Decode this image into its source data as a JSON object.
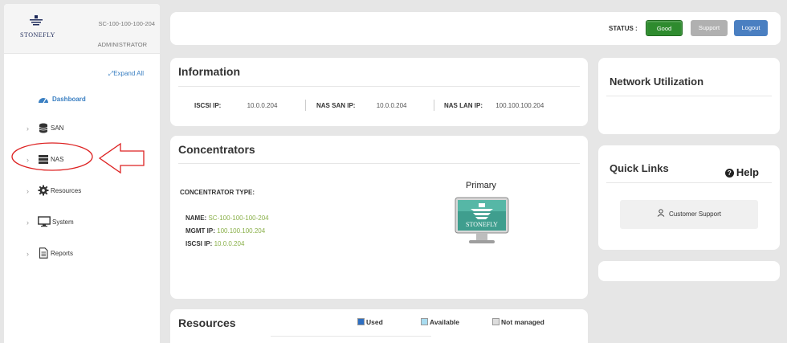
{
  "sidebar": {
    "hostname": "SC-100-100-100-204",
    "role": "ADMINISTRATOR",
    "logo_text": "STONEFLY",
    "expand_all": "Expand All",
    "dashboard": "Dashboard",
    "items": [
      {
        "label": "SAN",
        "icon": "database-icon"
      },
      {
        "label": "NAS",
        "icon": "server-icon"
      },
      {
        "label": "Resources",
        "icon": "gear-icon"
      },
      {
        "label": "System",
        "icon": "monitor-icon"
      },
      {
        "label": "Reports",
        "icon": "document-icon"
      }
    ]
  },
  "topbar": {
    "status_label": "STATUS :",
    "status_value": "Good",
    "support": "Support",
    "logout": "Logout",
    "colors": {
      "good": "#2e8b2e",
      "support": "#b0b0b0",
      "logout": "#4a7fc1"
    }
  },
  "information": {
    "title": "Information",
    "iscsi_label": "ISCSI IP:",
    "iscsi_value": "10.0.0.204",
    "nas_san_label": "NAS SAN IP:",
    "nas_san_value": "10.0.0.204",
    "nas_lan_label": "NAS LAN IP:",
    "nas_lan_value": "100.100.100.204"
  },
  "concentrators": {
    "title": "Concentrators",
    "type_label": "CONCENTRATOR TYPE:",
    "primary": "Primary",
    "name_label": "NAME:",
    "name_value": "SC-100-100-100-204",
    "mgmt_label": "MGMT IP:",
    "mgmt_value": "100.100.100.204",
    "iscsi_label": "ISCSI IP:",
    "iscsi_value": "10.0.0.204",
    "monitor_logo": "STONEFLY"
  },
  "resources": {
    "title": "Resources",
    "legend": [
      {
        "label": "Used",
        "color": "#2e6fc2"
      },
      {
        "label": "Available",
        "color": "#a9dcf0"
      },
      {
        "label": "Not managed",
        "color": "#dddddd"
      }
    ]
  },
  "network": {
    "title": "Network Utilization"
  },
  "quick_links": {
    "title": "Quick Links",
    "help": "Help",
    "customer_support": "Customer Support"
  }
}
